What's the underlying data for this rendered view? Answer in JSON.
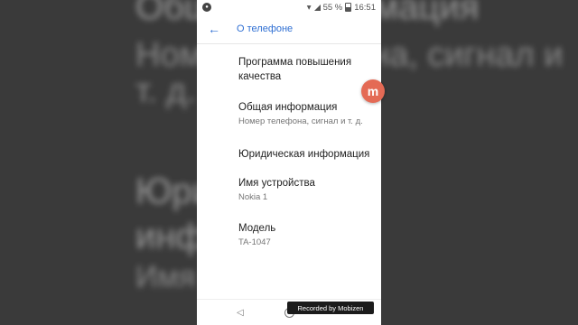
{
  "background": {
    "lines": [
      "Общая информация",
      "Номер телефона, сигнал и",
      "т. д.",
      "Юридическая",
      "информация",
      "Имя устройства"
    ]
  },
  "statusbar": {
    "battery": "55 %",
    "time": "16:51"
  },
  "toolbar": {
    "title": "О телефоне",
    "back_icon": "arrow-left-icon"
  },
  "items": [
    {
      "title": "Программа повышения качества",
      "subtitle": ""
    },
    {
      "title": "Общая информация",
      "subtitle": "Номер телефона, сигнал и т. д."
    },
    {
      "title": "Юридическая информация",
      "subtitle": ""
    },
    {
      "title": "Имя устройства",
      "subtitle": "Nokia 1"
    },
    {
      "title": "Модель",
      "subtitle": "TA-1047"
    }
  ],
  "recorder": {
    "label": "Recorded by Mobizen"
  },
  "float_button": {
    "label": "m"
  },
  "nav": {
    "back_icon": "triangle-back-icon",
    "home_icon": "circle-home-icon"
  }
}
